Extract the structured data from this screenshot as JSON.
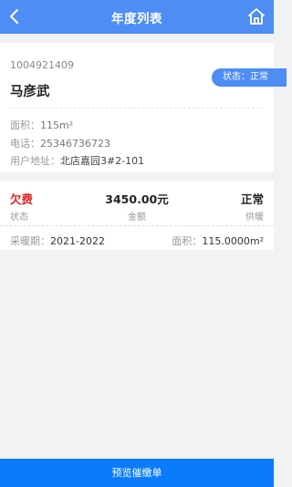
{
  "header": {
    "title": "年度列表",
    "back_icon": "chevron-left",
    "home_icon": "home"
  },
  "account": {
    "number": "1004921409",
    "name": "马彦武",
    "status_pill": "状态：正常",
    "area_label": "面积：",
    "area_value": "115m²",
    "phone_label": "电话：",
    "phone_value": "25346736723",
    "address_label": "用户地址：",
    "address_value": "北店嘉园3#2-101"
  },
  "year_item": {
    "debt_value": "欠费",
    "debt_label": "状态",
    "amount_value": "3450.00元",
    "amount_label": "金额",
    "supply_value": "正常",
    "supply_label": "供暖",
    "period_label": "采暖期：",
    "period_value": "2021-2022",
    "area_label": "面积：",
    "area_value": "115.0000m²"
  },
  "footer": {
    "button_label": "预览催缴单"
  },
  "colors": {
    "header": "#4e8df3",
    "debt": "#e02020",
    "footer": "#0a7cfb"
  }
}
